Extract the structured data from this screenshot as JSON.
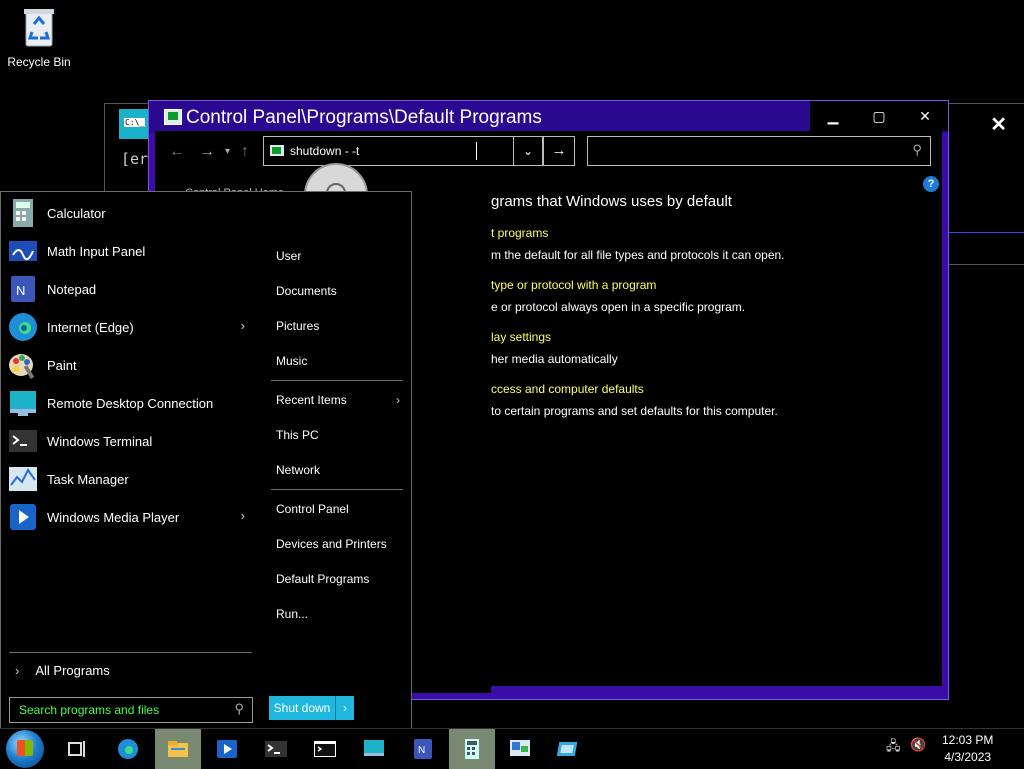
{
  "desktop": {
    "recycle_bin_label": "Recycle Bin"
  },
  "console_window": {
    "text": "[er"
  },
  "control_panel": {
    "title": "Control Panel\\Programs\\Default Programs",
    "address_value": "shutdown - -t",
    "left_text": "Control Panel Home",
    "heading": "grams that Windows uses by default",
    "items": [
      {
        "link": "t programs",
        "desc": "m the default for all file types and protocols it can open."
      },
      {
        "link": "type or protocol with a program",
        "desc": "e or protocol always open in a specific program."
      },
      {
        "link": "lay settings",
        "desc": "her media automatically"
      },
      {
        "link": "ccess and computer defaults",
        "desc": "to certain programs and set defaults for this computer."
      }
    ]
  },
  "start_menu": {
    "pinned": [
      {
        "label": "Calculator",
        "icon": "calculator-icon",
        "submenu": false
      },
      {
        "label": "Math Input Panel",
        "icon": "math-input-icon",
        "submenu": false
      },
      {
        "label": "Notepad",
        "icon": "notepad-icon",
        "submenu": false
      },
      {
        "label": "Internet (Edge)",
        "icon": "edge-icon",
        "submenu": true
      },
      {
        "label": "Paint",
        "icon": "paint-icon",
        "submenu": false
      },
      {
        "label": "Remote Desktop Connection",
        "icon": "remote-desktop-icon",
        "submenu": false
      },
      {
        "label": "Windows Terminal",
        "icon": "terminal-icon",
        "submenu": false
      },
      {
        "label": "Task Manager",
        "icon": "task-manager-icon",
        "submenu": false
      },
      {
        "label": "Windows Media Player",
        "icon": "media-player-icon",
        "submenu": true
      }
    ],
    "right_links": {
      "user": "User",
      "documents": "Documents",
      "pictures": "Pictures",
      "music": "Music",
      "recent_items": "Recent Items",
      "this_pc": "This PC",
      "network": "Network",
      "control_panel": "Control Panel",
      "devices_printers": "Devices and Printers",
      "default_programs": "Default Programs",
      "run": "Run..."
    },
    "all_programs": "All Programs",
    "search_placeholder": "Search programs and files",
    "shutdown_label": "Shut down"
  },
  "taskbar": {
    "time": "12:03 PM",
    "date": "4/3/2023"
  },
  "colors": {
    "accent_purple": "#3a0ca8",
    "link_yellow": "#ffff64",
    "search_green": "#49ff49",
    "shutdown_blue": "#20b7df"
  }
}
